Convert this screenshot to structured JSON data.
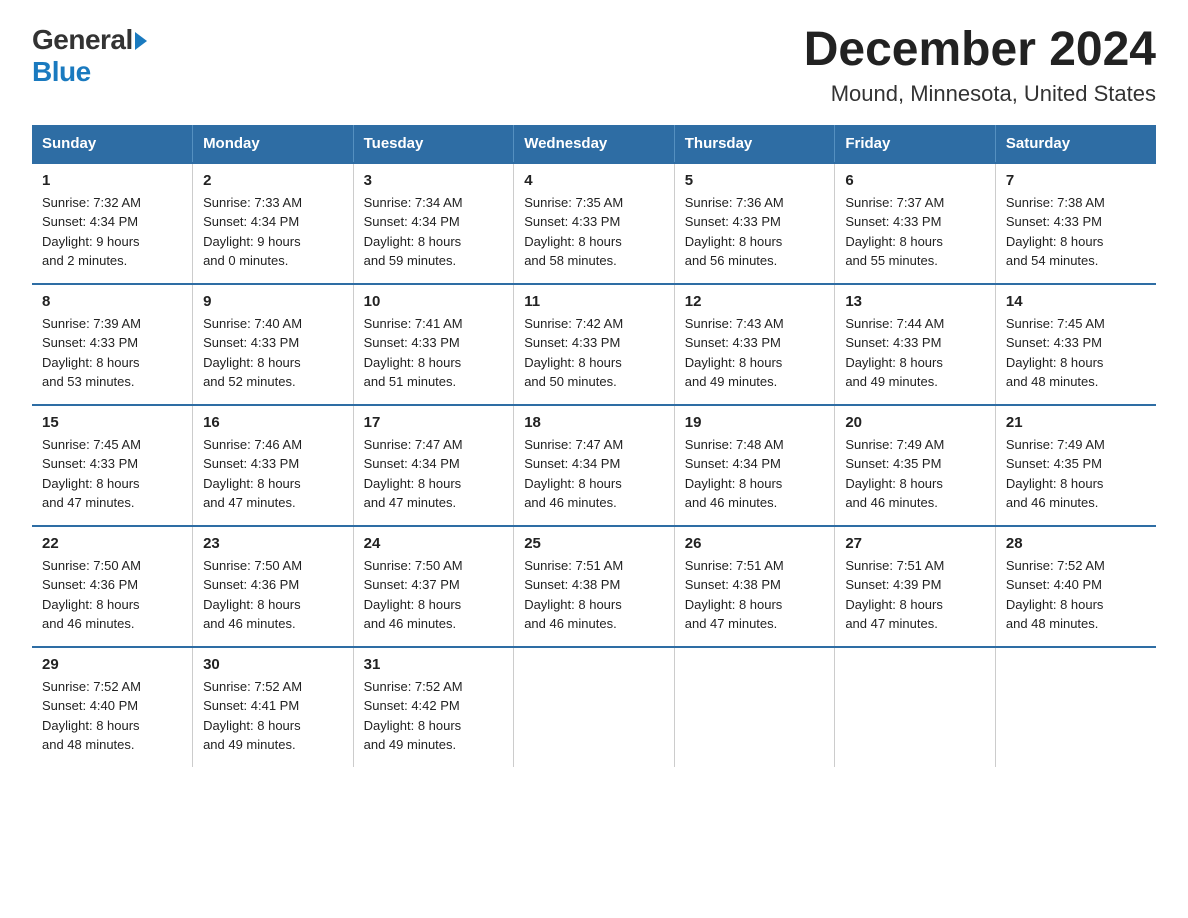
{
  "logo": {
    "general": "General",
    "blue": "Blue"
  },
  "title": "December 2024",
  "subtitle": "Mound, Minnesota, United States",
  "days_header": [
    "Sunday",
    "Monday",
    "Tuesday",
    "Wednesday",
    "Thursday",
    "Friday",
    "Saturday"
  ],
  "weeks": [
    [
      {
        "day": "1",
        "sunrise": "7:32 AM",
        "sunset": "4:34 PM",
        "daylight": "9 hours and 2 minutes."
      },
      {
        "day": "2",
        "sunrise": "7:33 AM",
        "sunset": "4:34 PM",
        "daylight": "9 hours and 0 minutes."
      },
      {
        "day": "3",
        "sunrise": "7:34 AM",
        "sunset": "4:34 PM",
        "daylight": "8 hours and 59 minutes."
      },
      {
        "day": "4",
        "sunrise": "7:35 AM",
        "sunset": "4:33 PM",
        "daylight": "8 hours and 58 minutes."
      },
      {
        "day": "5",
        "sunrise": "7:36 AM",
        "sunset": "4:33 PM",
        "daylight": "8 hours and 56 minutes."
      },
      {
        "day": "6",
        "sunrise": "7:37 AM",
        "sunset": "4:33 PM",
        "daylight": "8 hours and 55 minutes."
      },
      {
        "day": "7",
        "sunrise": "7:38 AM",
        "sunset": "4:33 PM",
        "daylight": "8 hours and 54 minutes."
      }
    ],
    [
      {
        "day": "8",
        "sunrise": "7:39 AM",
        "sunset": "4:33 PM",
        "daylight": "8 hours and 53 minutes."
      },
      {
        "day": "9",
        "sunrise": "7:40 AM",
        "sunset": "4:33 PM",
        "daylight": "8 hours and 52 minutes."
      },
      {
        "day": "10",
        "sunrise": "7:41 AM",
        "sunset": "4:33 PM",
        "daylight": "8 hours and 51 minutes."
      },
      {
        "day": "11",
        "sunrise": "7:42 AM",
        "sunset": "4:33 PM",
        "daylight": "8 hours and 50 minutes."
      },
      {
        "day": "12",
        "sunrise": "7:43 AM",
        "sunset": "4:33 PM",
        "daylight": "8 hours and 49 minutes."
      },
      {
        "day": "13",
        "sunrise": "7:44 AM",
        "sunset": "4:33 PM",
        "daylight": "8 hours and 49 minutes."
      },
      {
        "day": "14",
        "sunrise": "7:45 AM",
        "sunset": "4:33 PM",
        "daylight": "8 hours and 48 minutes."
      }
    ],
    [
      {
        "day": "15",
        "sunrise": "7:45 AM",
        "sunset": "4:33 PM",
        "daylight": "8 hours and 47 minutes."
      },
      {
        "day": "16",
        "sunrise": "7:46 AM",
        "sunset": "4:33 PM",
        "daylight": "8 hours and 47 minutes."
      },
      {
        "day": "17",
        "sunrise": "7:47 AM",
        "sunset": "4:34 PM",
        "daylight": "8 hours and 47 minutes."
      },
      {
        "day": "18",
        "sunrise": "7:47 AM",
        "sunset": "4:34 PM",
        "daylight": "8 hours and 46 minutes."
      },
      {
        "day": "19",
        "sunrise": "7:48 AM",
        "sunset": "4:34 PM",
        "daylight": "8 hours and 46 minutes."
      },
      {
        "day": "20",
        "sunrise": "7:49 AM",
        "sunset": "4:35 PM",
        "daylight": "8 hours and 46 minutes."
      },
      {
        "day": "21",
        "sunrise": "7:49 AM",
        "sunset": "4:35 PM",
        "daylight": "8 hours and 46 minutes."
      }
    ],
    [
      {
        "day": "22",
        "sunrise": "7:50 AM",
        "sunset": "4:36 PM",
        "daylight": "8 hours and 46 minutes."
      },
      {
        "day": "23",
        "sunrise": "7:50 AM",
        "sunset": "4:36 PM",
        "daylight": "8 hours and 46 minutes."
      },
      {
        "day": "24",
        "sunrise": "7:50 AM",
        "sunset": "4:37 PM",
        "daylight": "8 hours and 46 minutes."
      },
      {
        "day": "25",
        "sunrise": "7:51 AM",
        "sunset": "4:38 PM",
        "daylight": "8 hours and 46 minutes."
      },
      {
        "day": "26",
        "sunrise": "7:51 AM",
        "sunset": "4:38 PM",
        "daylight": "8 hours and 47 minutes."
      },
      {
        "day": "27",
        "sunrise": "7:51 AM",
        "sunset": "4:39 PM",
        "daylight": "8 hours and 47 minutes."
      },
      {
        "day": "28",
        "sunrise": "7:52 AM",
        "sunset": "4:40 PM",
        "daylight": "8 hours and 48 minutes."
      }
    ],
    [
      {
        "day": "29",
        "sunrise": "7:52 AM",
        "sunset": "4:40 PM",
        "daylight": "8 hours and 48 minutes."
      },
      {
        "day": "30",
        "sunrise": "7:52 AM",
        "sunset": "4:41 PM",
        "daylight": "8 hours and 49 minutes."
      },
      {
        "day": "31",
        "sunrise": "7:52 AM",
        "sunset": "4:42 PM",
        "daylight": "8 hours and 49 minutes."
      },
      null,
      null,
      null,
      null
    ]
  ],
  "labels": {
    "sunrise": "Sunrise:",
    "sunset": "Sunset:",
    "daylight": "Daylight:"
  }
}
